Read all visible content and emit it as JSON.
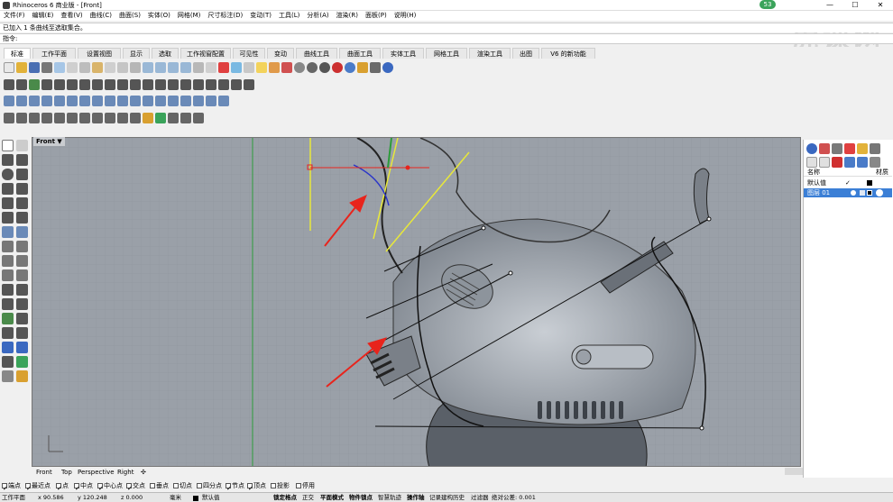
{
  "window": {
    "title": "Rhinoceros 6 商业版 - [Front]",
    "minimize": "—",
    "maximize": "☐",
    "close": "✕"
  },
  "menu": [
    "文件(F)",
    "编辑(E)",
    "查看(V)",
    "曲线(C)",
    "曲面(S)",
    "实体(O)",
    "网格(M)",
    "尺寸标注(D)",
    "变动(T)",
    "工具(L)",
    "分析(A)",
    "渲染(R)",
    "面板(P)",
    "说明(H)"
  ],
  "command_history": "已加入 1 条曲线至选取集合。",
  "command_prompt": "指令:",
  "tabs": [
    "标准",
    "工作平面",
    "设置视图",
    "显示",
    "选取",
    "工作视窗配置",
    "可见性",
    "变动",
    "曲线工具",
    "曲面工具",
    "实体工具",
    "网格工具",
    "渲染工具",
    "出图",
    "V6 的新功能"
  ],
  "viewport": {
    "label": "Front",
    "menu_arrow": "▼"
  },
  "viewport_tabs": [
    "Front",
    "Top",
    "Perspective",
    "Right",
    "✣"
  ],
  "osnaps": [
    {
      "label": "端点",
      "checked": true
    },
    {
      "label": "最近点",
      "checked": true
    },
    {
      "label": "点",
      "checked": true
    },
    {
      "label": "中点",
      "checked": true
    },
    {
      "label": "中心点",
      "checked": true
    },
    {
      "label": "交点",
      "checked": true
    },
    {
      "label": "垂点",
      "checked": false
    },
    {
      "label": "切点",
      "checked": false
    },
    {
      "label": "四分点",
      "checked": false
    },
    {
      "label": "节点",
      "checked": true
    },
    {
      "label": "顶点",
      "checked": true
    },
    {
      "label": "投影",
      "checked": false
    },
    {
      "label": "停用",
      "checked": false
    }
  ],
  "status": {
    "cplane": "工作平面",
    "x": "x 90.586",
    "y": "y 120.248",
    "z": "z 0.000",
    "unit": "毫米",
    "layer": "默认值",
    "items": [
      "锁定格点",
      "正交",
      "平面模式",
      "物件锁点",
      "智慧轨迹",
      "操作轴",
      "记录建构历史",
      "过滤器"
    ],
    "tolerance": "绝对公差: 0.001"
  },
  "layers": {
    "header_name": "名称",
    "header_material": "材质",
    "rows": [
      {
        "name": "默认值",
        "check": "✓"
      },
      {
        "name": "图层 01",
        "selected": true
      }
    ]
  },
  "watermark": "虎课网",
  "badge": "53",
  "colors": {
    "accent": "#3b7fd6",
    "viewport_bg": "#9aa0a8",
    "yellow_line": "#e8e83a",
    "red_arrow": "#e8241c"
  }
}
